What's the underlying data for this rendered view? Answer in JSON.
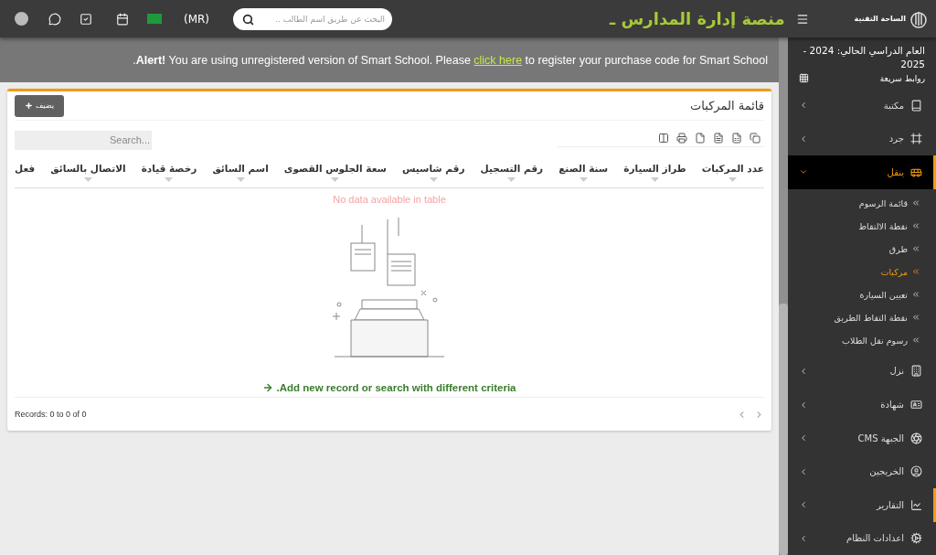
{
  "topbar": {
    "user_tag": "(MR)",
    "search": {
      "placeholder": "البحث عن طريق اسم الطالب .."
    },
    "title": "منصة إدارة المدارس ـ",
    "brand": "الساحة التقنية"
  },
  "alert": {
    "lead": ".",
    "label": "Alert!",
    "before": " You are using unregistered version of Smart School. Please ",
    "link": "click here",
    "after": " to register your purchase code for Smart School"
  },
  "sidebar": {
    "session": "العام الدراسي الحالي: 2024 - 2025",
    "quick_links": "روابط سريعة",
    "items": [
      {
        "label": "مكتبة",
        "selected": false,
        "expanded": false,
        "marked": false
      },
      {
        "label": "جرد",
        "selected": false,
        "expanded": false,
        "marked": false
      },
      {
        "label": "ينقل",
        "selected": true,
        "expanded": true,
        "marked": false,
        "children": [
          {
            "label": "قائمة الرسوم",
            "selected": false
          },
          {
            "label": "نقطة الالتقاط",
            "selected": false
          },
          {
            "label": "طرق",
            "selected": false
          },
          {
            "label": "مركبات",
            "selected": true
          },
          {
            "label": "تعيين السيارة",
            "selected": false
          },
          {
            "label": "نقطة التقاط الطريق",
            "selected": false
          },
          {
            "label": "رسوم نقل الطلاب",
            "selected": false
          }
        ]
      },
      {
        "label": "نزل",
        "selected": false,
        "expanded": false,
        "marked": false
      },
      {
        "label": "شهادة",
        "selected": false,
        "expanded": false,
        "marked": false
      },
      {
        "label": "الجبهة CMS",
        "selected": false,
        "expanded": false,
        "marked": false
      },
      {
        "label": "الخريجين",
        "selected": false,
        "expanded": false,
        "marked": false
      },
      {
        "label": "التقارير",
        "selected": false,
        "expanded": false,
        "marked": true
      },
      {
        "label": "اعدادات النظام",
        "selected": false,
        "expanded": false,
        "marked": false
      }
    ]
  },
  "card": {
    "title": "قائمة المركبات",
    "add_button": "يضيف",
    "search": {
      "placeholder": "Search..."
    },
    "columns": [
      "عدد المركبات",
      "طراز السيارة",
      "سنة الصنع",
      "رقم التسجيل",
      "رقم شاسيس",
      "سعة الجلوس القصوى",
      "اسم السائق",
      "رخصة قيادة",
      "الاتصال بالسائق",
      "فعل"
    ],
    "sortable": [
      true,
      true,
      true,
      true,
      true,
      true,
      true,
      true,
      true,
      false
    ],
    "empty_message": "No data available in table",
    "empty_hint": ".Add new record or search with different criteria",
    "records": "Records: 0 to 0 of 0"
  }
}
